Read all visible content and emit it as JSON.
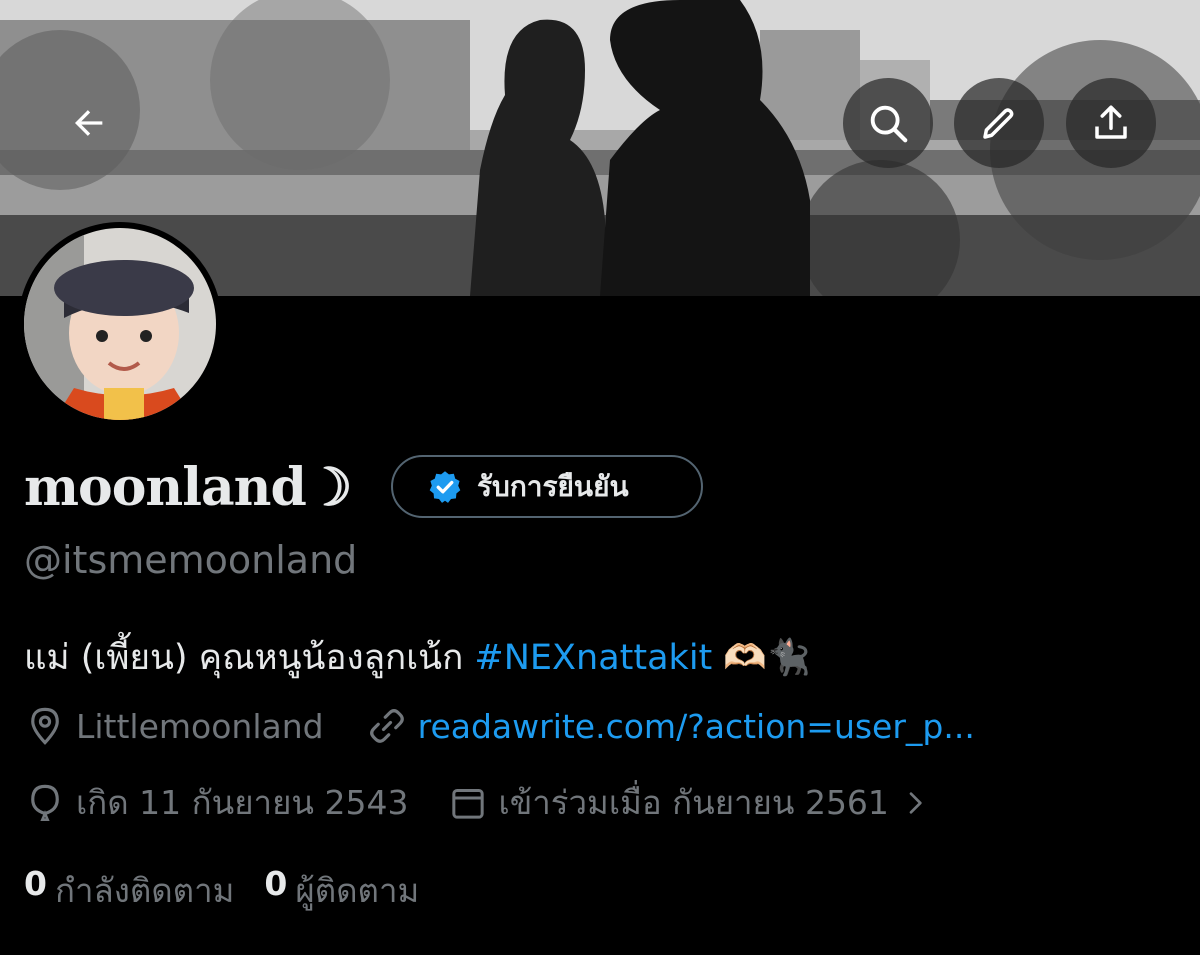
{
  "header": {
    "back_icon": "arrow-left-icon",
    "actions": [
      "search-icon",
      "pencil-icon",
      "share-icon"
    ]
  },
  "profile": {
    "display_name": "moonland☽",
    "verify_label": "รับการยืนยัน",
    "handle": "@itsmemoonland",
    "bio_text": "แม่ (เพี้ยน) คุณหนูน้องลูกเน้ก ",
    "bio_hashtag": "#NEXnattakit",
    "bio_emoji": " 🫶🏻🐈‍⬛",
    "location": "Littlemoonland",
    "website": "readawrite.com/?action=user_p...",
    "birthday": "เกิด 11 กันยายน 2543",
    "joined": "เข้าร่วมเมื่อ กันยายน 2561",
    "following_count": "0",
    "following_label": "กำลังติดตาม",
    "followers_count": "0",
    "followers_label": "ผู้ติดตาม"
  },
  "colors": {
    "accent": "#1d9bf0",
    "muted": "#71767b",
    "text": "#e7e9ea",
    "background": "#000000"
  }
}
